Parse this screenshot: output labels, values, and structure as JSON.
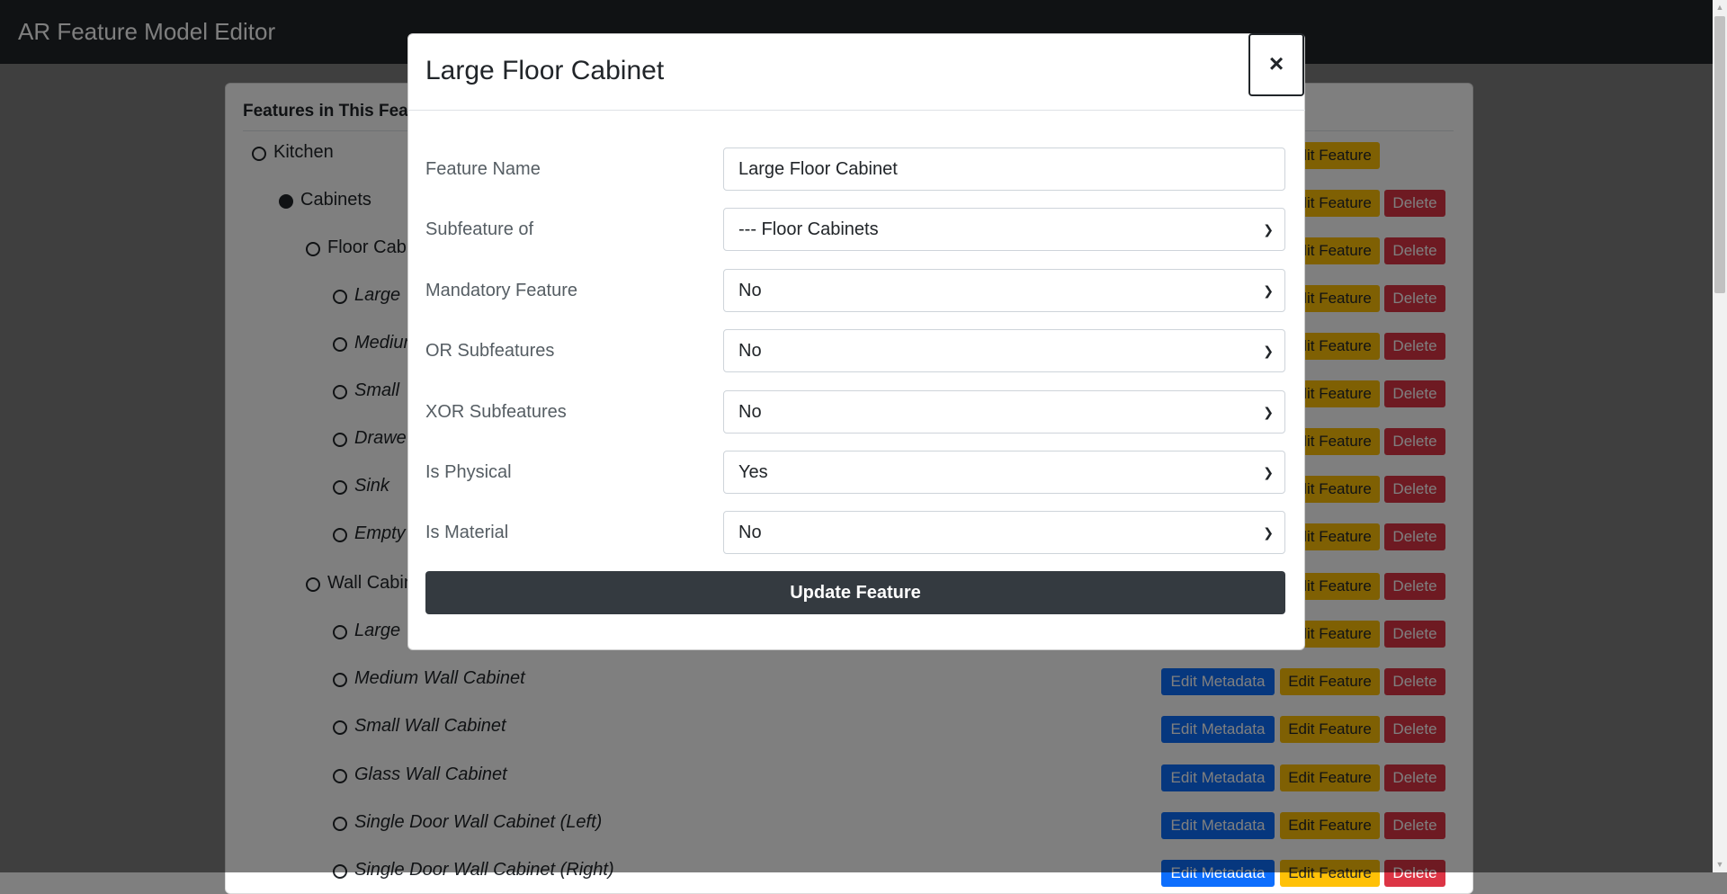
{
  "app": {
    "title": "AR Feature Model Editor"
  },
  "card": {
    "title": "Features in This Feat"
  },
  "tree": [
    {
      "label": "Kitchen",
      "filled": false,
      "italic": false,
      "buttons": [
        "Edit Feature"
      ]
    },
    {
      "label": "Cabinets",
      "filled": true,
      "italic": false,
      "buttons": [
        "Edit Feature",
        "Delete"
      ]
    },
    {
      "label": "Floor Cabi",
      "filled": false,
      "italic": false,
      "buttons": [
        "Edit Feature",
        "Delete"
      ]
    },
    {
      "label": "Large",
      "filled": false,
      "italic": true,
      "buttons": [
        "Edit Feature",
        "Delete"
      ]
    },
    {
      "label": "Mediun",
      "filled": false,
      "italic": true,
      "buttons": [
        "Edit Feature",
        "Delete"
      ]
    },
    {
      "label": "Small",
      "filled": false,
      "italic": true,
      "buttons": [
        "Edit Feature",
        "Delete"
      ]
    },
    {
      "label": "Drawe",
      "filled": false,
      "italic": true,
      "buttons": [
        "Edit Feature",
        "Delete"
      ]
    },
    {
      "label": "Sink",
      "filled": false,
      "italic": true,
      "buttons": [
        "Edit Feature",
        "Delete"
      ]
    },
    {
      "label": "Empty",
      "filled": false,
      "italic": true,
      "buttons": [
        "Edit Feature",
        "Delete"
      ]
    },
    {
      "label": "Wall Cabin",
      "filled": false,
      "italic": false,
      "buttons": [
        "Edit Feature",
        "Delete"
      ]
    },
    {
      "label": "Large",
      "filled": false,
      "italic": true,
      "buttons": [
        "Edit Feature",
        "Delete"
      ]
    },
    {
      "label": "Medium Wall Cabinet",
      "filled": false,
      "italic": true,
      "buttons": [
        "Edit Metadata",
        "Edit Feature",
        "Delete"
      ]
    },
    {
      "label": "Small Wall Cabinet",
      "filled": false,
      "italic": true,
      "buttons": [
        "Edit Metadata",
        "Edit Feature",
        "Delete"
      ]
    },
    {
      "label": "Glass Wall Cabinet",
      "filled": false,
      "italic": true,
      "buttons": [
        "Edit Metadata",
        "Edit Feature",
        "Delete"
      ]
    },
    {
      "label": "Single Door Wall Cabinet (Left)",
      "filled": false,
      "italic": true,
      "buttons": [
        "Edit Metadata",
        "Edit Feature",
        "Delete"
      ]
    },
    {
      "label": "Single Door Wall Cabinet (Right)",
      "filled": false,
      "italic": true,
      "buttons": [
        "Edit Metadata",
        "Edit Feature",
        "Delete"
      ]
    }
  ],
  "modal": {
    "title": "Large Floor Cabinet",
    "close_label": "×",
    "fields": [
      {
        "label": "Feature Name",
        "value": "Large Floor Cabinet",
        "type": "text"
      },
      {
        "label": "Subfeature of",
        "value": "--- Floor Cabinets",
        "type": "select"
      },
      {
        "label": "Mandatory Feature",
        "value": "No",
        "type": "select"
      },
      {
        "label": "OR Subfeatures",
        "value": "No",
        "type": "select"
      },
      {
        "label": "XOR Subfeatures",
        "value": "No",
        "type": "select"
      },
      {
        "label": "Is Physical",
        "value": "Yes",
        "type": "select"
      },
      {
        "label": "Is Material",
        "value": "No",
        "type": "select"
      }
    ],
    "submit_label": "Update Feature"
  },
  "colors": {
    "navbar": "#212529",
    "primary": "#0d6efd",
    "warning": "#ffc107",
    "danger": "#dc3545",
    "dark_button": "#343a40"
  }
}
